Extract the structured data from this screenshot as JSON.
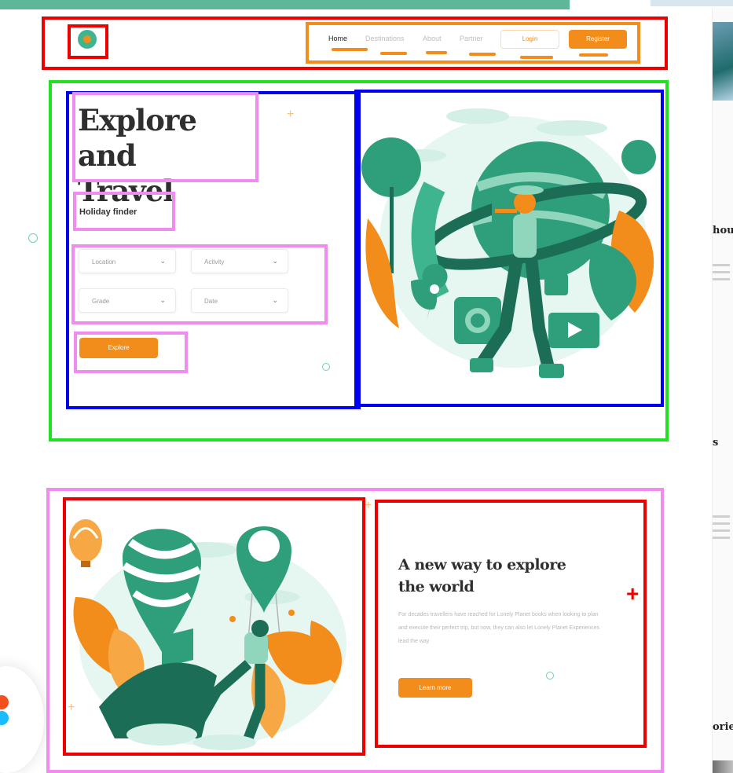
{
  "nav": {
    "links": [
      "Home",
      "Destinations",
      "About",
      "Partner"
    ],
    "login_label": "Login",
    "register_label": "Register"
  },
  "hero": {
    "title_line1": "Explore and",
    "title_line2": "Travel",
    "subtitle": "Holiday finder",
    "filters": {
      "location": "Location",
      "activity": "Activity",
      "grade": "Grade",
      "date": "Date"
    },
    "explore_label": "Explore"
  },
  "section2": {
    "title": "A new way to explore the world",
    "body": "For decades travellers have reached for Lonely Planet books when looking to plan and execute their perfect trip, but now, they can also let Lonely Planet Experiences lead the way",
    "cta_label": "Learn more"
  },
  "side_page": {
    "text1": "hou",
    "text2": "s",
    "text3": "orie"
  },
  "colors": {
    "accent": "#f28c1a",
    "brand_green": "#3fb58f",
    "dark_green": "#1f7a5c",
    "annotation_red": "#ee0000",
    "annotation_orange": "#f28c1a",
    "annotation_green": "#22e022",
    "annotation_blue": "#0000ee",
    "annotation_pink": "#f08cef"
  }
}
